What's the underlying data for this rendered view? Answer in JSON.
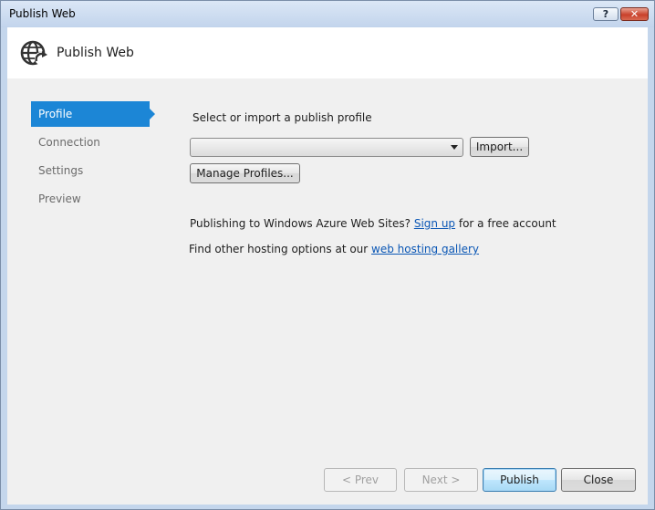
{
  "window": {
    "title": "Publish Web",
    "help_label": "?",
    "close_label": "✕"
  },
  "header": {
    "title": "Publish Web",
    "icon": "globe-publish-icon"
  },
  "nav": {
    "items": [
      {
        "label": "Profile",
        "selected": true
      },
      {
        "label": "Connection",
        "selected": false
      },
      {
        "label": "Settings",
        "selected": false
      },
      {
        "label": "Preview",
        "selected": false
      }
    ]
  },
  "profile": {
    "select_label": "Select or import a publish profile",
    "selected_value": "",
    "import_label": "Import...",
    "manage_label": "Manage Profiles..."
  },
  "azure": {
    "text_before": "Publishing to Windows Azure Web Sites? ",
    "link": "Sign up",
    "text_after": " for a free account"
  },
  "hosting": {
    "text_before": "Find other hosting options at our ",
    "link": "web hosting gallery"
  },
  "footer": {
    "prev_label": "< Prev",
    "next_label": "Next >",
    "publish_label": "Publish",
    "close_label": "Close"
  },
  "colors": {
    "selected_nav": "#1c86d6",
    "link": "#0b57b5",
    "frame": "#c4d6ec"
  }
}
